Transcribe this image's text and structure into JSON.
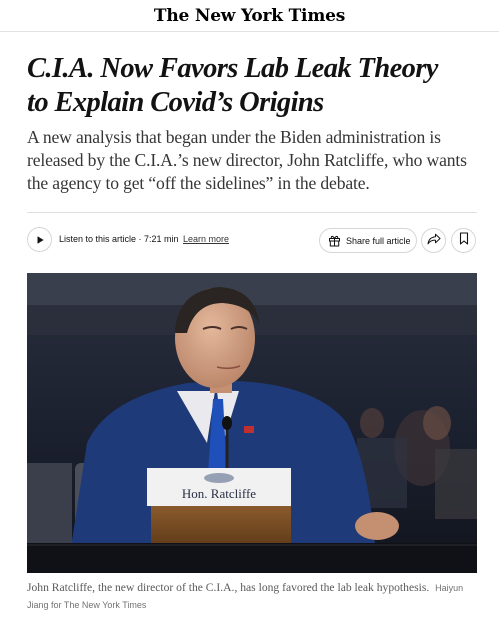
{
  "masthead": {
    "logo_text": "The New York Times"
  },
  "article": {
    "headline_line1": "C.I.A. Now Favors Lab Leak Theory",
    "headline_line2": "to Explain Covid’s Origins",
    "summary": "A new analysis that began under the Biden administration is released by the C.I.A.’s new director, John Ratcliffe, who wants the agency to get “off the sidelines” in the debate."
  },
  "toolbar": {
    "play_icon": "play-icon",
    "listen_label": "Listen to this article · 7:21 min",
    "learn_more": "Learn more",
    "share_label": "Share full article",
    "gift_icon": "gift-icon",
    "forward_icon": "share-arrow-icon",
    "bookmark_icon": "bookmark-icon"
  },
  "photo": {
    "nameplate": "Hon. Ratcliffe",
    "caption": "John Ratcliffe, the new director of the C.I.A., has long favored the lab leak hypothesis.",
    "credit": "Haiyun Jiang for The New York Times"
  },
  "colors": {
    "text_primary": "#121212",
    "text_secondary": "#363636",
    "caption": "#5a5a5a",
    "border": "#d6d6d6",
    "suit_blue": "#1e3a78",
    "tie_blue": "#1f4fb8"
  }
}
